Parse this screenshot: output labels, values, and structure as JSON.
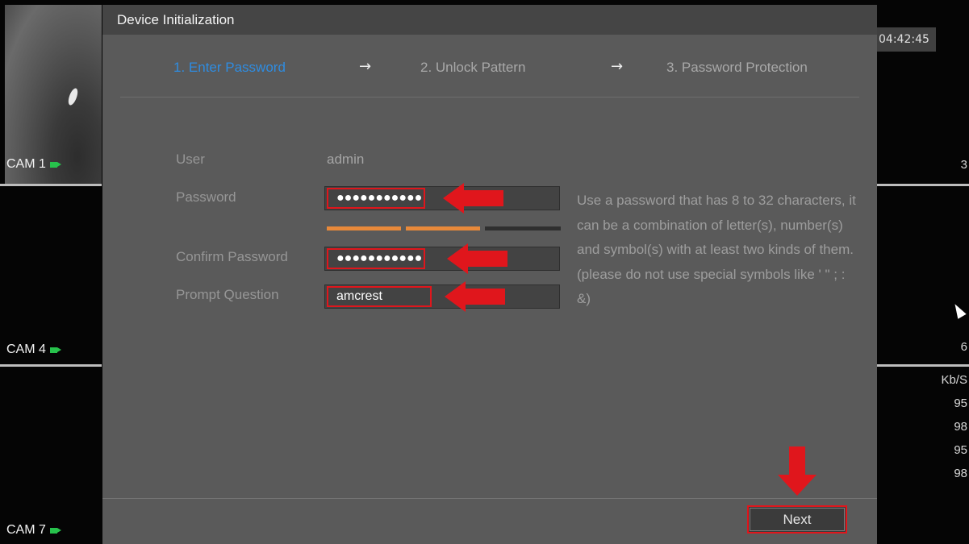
{
  "dialog": {
    "title": "Device Initialization",
    "steps": [
      {
        "label": "1.  Enter Password",
        "active": true
      },
      {
        "label": "2.  Unlock Pattern",
        "active": false
      },
      {
        "label": "3.  Password Protection",
        "active": false
      }
    ],
    "step_arrow": "→",
    "user_label": "User",
    "user_value": "admin",
    "password_label": "Password",
    "password_value": "●●●●●●●●●●●",
    "confirm_label": "Confirm Password",
    "confirm_value": "●●●●●●●●●●●",
    "prompt_label": "Prompt Question",
    "prompt_value": "amcrest",
    "help_text": "Use a password that has 8 to 32 characters, it can be a combination of letter(s), number(s) and symbol(s) with at least two kinds of them.(please do not use special symbols like ' \" ; : &)",
    "next_label": "Next",
    "password_strength_segments_filled": 2,
    "password_strength_segments_total": 3
  },
  "background": {
    "cameras": [
      "CAM 1",
      "CAM 4",
      "CAM 7"
    ],
    "time": "04:42:45",
    "right_texts": [
      "3",
      "6",
      "Kb/S",
      "95",
      "98",
      "95",
      "98"
    ]
  },
  "colors": {
    "active_step": "#2f8ce0",
    "highlight_red": "#e0161c",
    "strength_orange": "#e8893a",
    "camera_icon_green": "#27c24c"
  }
}
